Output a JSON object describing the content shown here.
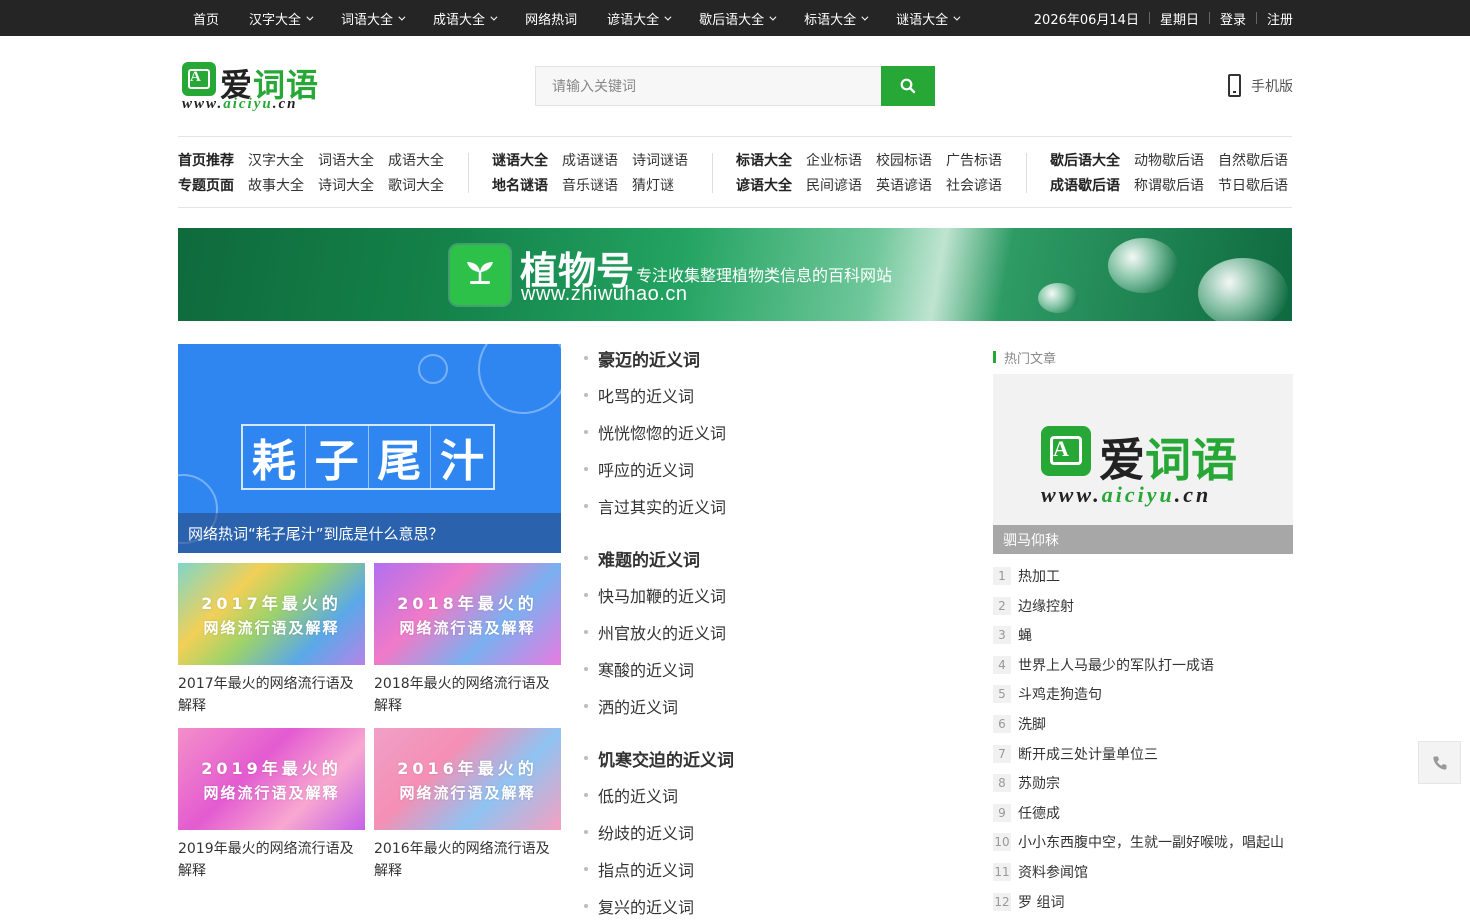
{
  "topnav": {
    "items": [
      {
        "label": "首页",
        "dropdown": false
      },
      {
        "label": "汉字大全",
        "dropdown": true
      },
      {
        "label": "词语大全",
        "dropdown": true
      },
      {
        "label": "成语大全",
        "dropdown": true
      },
      {
        "label": "网络热词",
        "dropdown": false
      },
      {
        "label": "谚语大全",
        "dropdown": true
      },
      {
        "label": "歇后语大全",
        "dropdown": true
      },
      {
        "label": "标语大全",
        "dropdown": true
      },
      {
        "label": "谜语大全",
        "dropdown": true
      }
    ],
    "date": "2026年06月14日",
    "weekday": "星期日",
    "login": "登录",
    "register": "注册"
  },
  "header": {
    "logo_name_a": "爱",
    "logo_name_b": "词语",
    "logo_mark": "A",
    "logo_url_a": "www.",
    "logo_url_b": "aiciyu",
    "logo_url_c": ".cn",
    "search_placeholder": "请输入关键词",
    "mobile_label": "手机版"
  },
  "catnav": {
    "groups": [
      {
        "rows": [
          [
            "首页推荐",
            "汉字大全",
            "词语大全",
            "成语大全"
          ],
          [
            "专题页面",
            "故事大全",
            "诗词大全",
            "歌词大全"
          ]
        ]
      },
      {
        "rows": [
          [
            "谜语大全",
            "成语谜语",
            "诗词谜语"
          ],
          [
            "地名谜语",
            "音乐谜语",
            "猜灯谜"
          ]
        ]
      },
      {
        "rows": [
          [
            "标语大全",
            "企业标语",
            "校园标语",
            "广告标语"
          ],
          [
            "谚语大全",
            "民间谚语",
            "英语谚语",
            "社会谚语"
          ]
        ]
      },
      {
        "rows": [
          [
            "歇后语大全",
            "动物歇后语",
            "自然歇后语"
          ],
          [
            "成语歇后语",
            "称谓歇后语",
            "节日歇后语"
          ]
        ]
      }
    ]
  },
  "banner": {
    "title": "植物号",
    "subtitle": "专注收集整理植物类信息的百科网站",
    "url": "www.zhiwuhao.cn"
  },
  "featured": {
    "image_chars": [
      "耗",
      "子",
      "尾",
      "汁"
    ],
    "caption": "网络热词“耗子尾汁”到底是什么意思？"
  },
  "thumbs": [
    {
      "line1": "2017年最火的",
      "line2": "网络流行语及解释",
      "title": "2017年最火的网络流行语及解释"
    },
    {
      "line1": "2018年最火的",
      "line2": "网络流行语及解释",
      "title": "2018年最火的网络流行语及解释"
    },
    {
      "line1": "2019年最火的",
      "line2": "网络流行语及解释",
      "title": "2019年最火的网络流行语及解释"
    },
    {
      "line1": "2016年最火的",
      "line2": "网络流行语及解释",
      "title": "2016年最火的网络流行语及解释"
    }
  ],
  "lists": [
    {
      "head": "豪迈的近义词",
      "items": [
        "叱骂的近义词",
        "恍恍惚惚的近义词",
        "呼应的近义词",
        "言过其实的近义词"
      ]
    },
    {
      "head": "难题的近义词",
      "items": [
        "快马加鞭的近义词",
        "州官放火的近义词",
        "寒酸的近义词",
        "洒的近义词"
      ]
    },
    {
      "head": "饥寒交迫的近义词",
      "items": [
        "低的近义词",
        "纷歧的近义词",
        "指点的近义词",
        "复兴的近义词"
      ]
    }
  ],
  "sidebar": {
    "heading": "热门文章",
    "card_caption": "驷马仰秣",
    "ranks": [
      {
        "n": "1",
        "text": "热加工"
      },
      {
        "n": "2",
        "text": "边缘控射"
      },
      {
        "n": "3",
        "text": "蝇"
      },
      {
        "n": "4",
        "text": "世界上人马最少的军队打一成语"
      },
      {
        "n": "5",
        "text": "斗鸡走狗造句"
      },
      {
        "n": "6",
        "text": "洗脚"
      },
      {
        "n": "7",
        "text": "断开成三处计量单位三"
      },
      {
        "n": "8",
        "text": "苏勋宗"
      },
      {
        "n": "9",
        "text": "任德成"
      },
      {
        "n": "10",
        "text": "小小东西腹中空，生就一副好喉咙，唱起山"
      },
      {
        "n": "11",
        "text": "资料参闻馆"
      },
      {
        "n": "12",
        "text": "罗 组词"
      }
    ]
  },
  "colors": {
    "accent": "#27a836",
    "topbar": "#252525"
  }
}
